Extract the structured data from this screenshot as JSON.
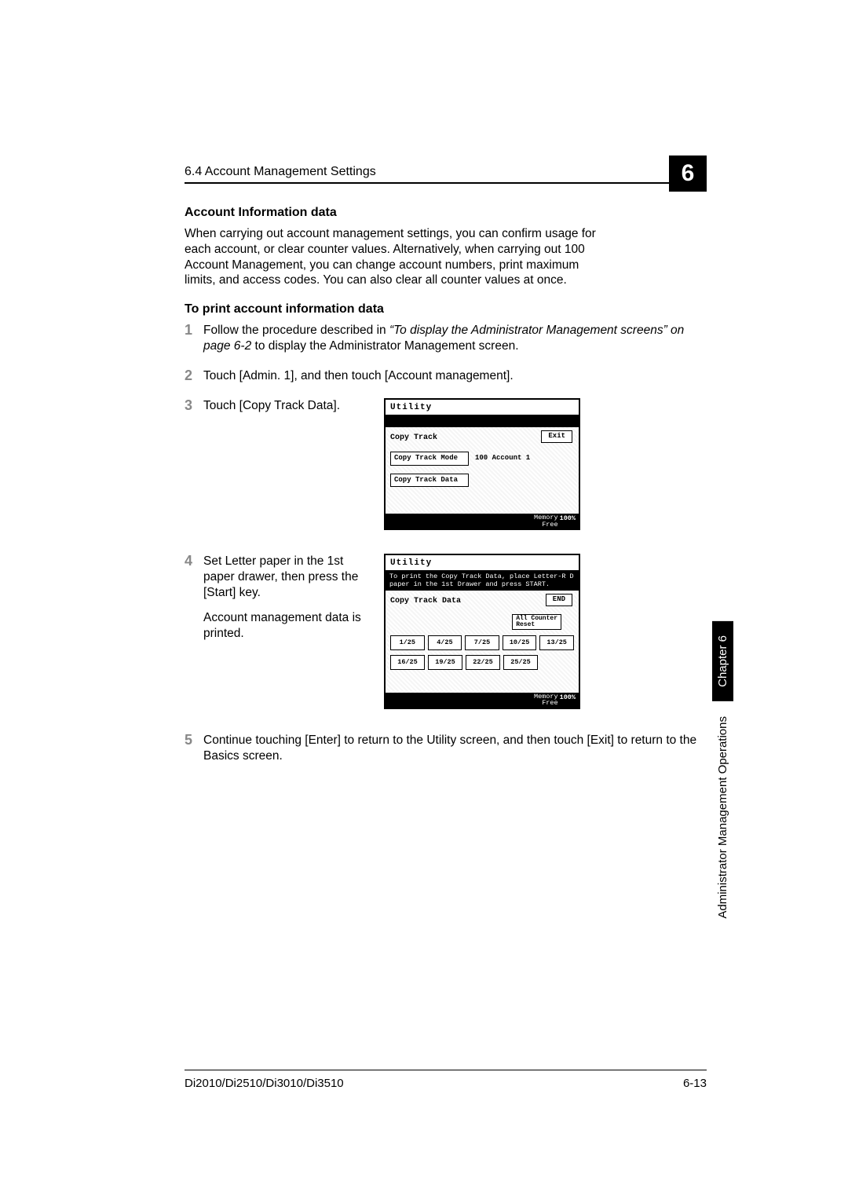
{
  "header": {
    "section": "6.4 Account Management Settings",
    "chapter_num": "6"
  },
  "h1": "Account Information data",
  "intro": "When carrying out account management settings, you can confirm usage for each account, or clear counter values. Alternatively, when carrying out 100 Account Management, you can change account numbers, print maximum limits, and access codes. You can also clear all counter values at once.",
  "h2": "To print account information data",
  "steps": {
    "s1": {
      "num": "1",
      "pre": "Follow the procedure described in ",
      "ital": "“To display the Administrator Management screens” on page 6-2",
      "post": " to display the Administrator Management screen."
    },
    "s2": {
      "num": "2",
      "text": "Touch [Admin. 1], and then touch [Account management]."
    },
    "s3": {
      "num": "3",
      "text": "Touch [Copy Track Data]."
    },
    "s4": {
      "num": "4",
      "p1": "Set Letter paper in the 1st paper drawer, then press the [Start] key.",
      "p2": "Account management data is printed."
    },
    "s5": {
      "num": "5",
      "text": "Continue touching [Enter] to return to the Utility screen, and then touch [Exit] to return to the Basics screen."
    }
  },
  "screen1": {
    "title": "Utility",
    "section": "Copy Track",
    "exit": "Exit",
    "btn1": "Copy Track Mode",
    "right1": "100 Account 1",
    "btn2": "Copy Track Data",
    "mem_lbl": "Memory\nFree",
    "mem_pct": "100%"
  },
  "screen2": {
    "title": "Utility",
    "msg": "To print the Copy Track Data, place Letter-R D paper in the 1st Drawer and press START.",
    "section": "Copy Track Data",
    "end": "END",
    "allcounter": "All Counter\nReset",
    "row1": [
      "1/25",
      "4/25",
      "7/25",
      "10/25",
      "13/25"
    ],
    "row2": [
      "16/25",
      "19/25",
      "22/25",
      "25/25"
    ],
    "mem_lbl": "Memory\nFree",
    "mem_pct": "100%"
  },
  "side": {
    "chapter": "Chapter 6",
    "section": "Administrator Management Operations"
  },
  "footer": {
    "model": "Di2010/Di2510/Di3010/Di3510",
    "page": "6-13"
  }
}
